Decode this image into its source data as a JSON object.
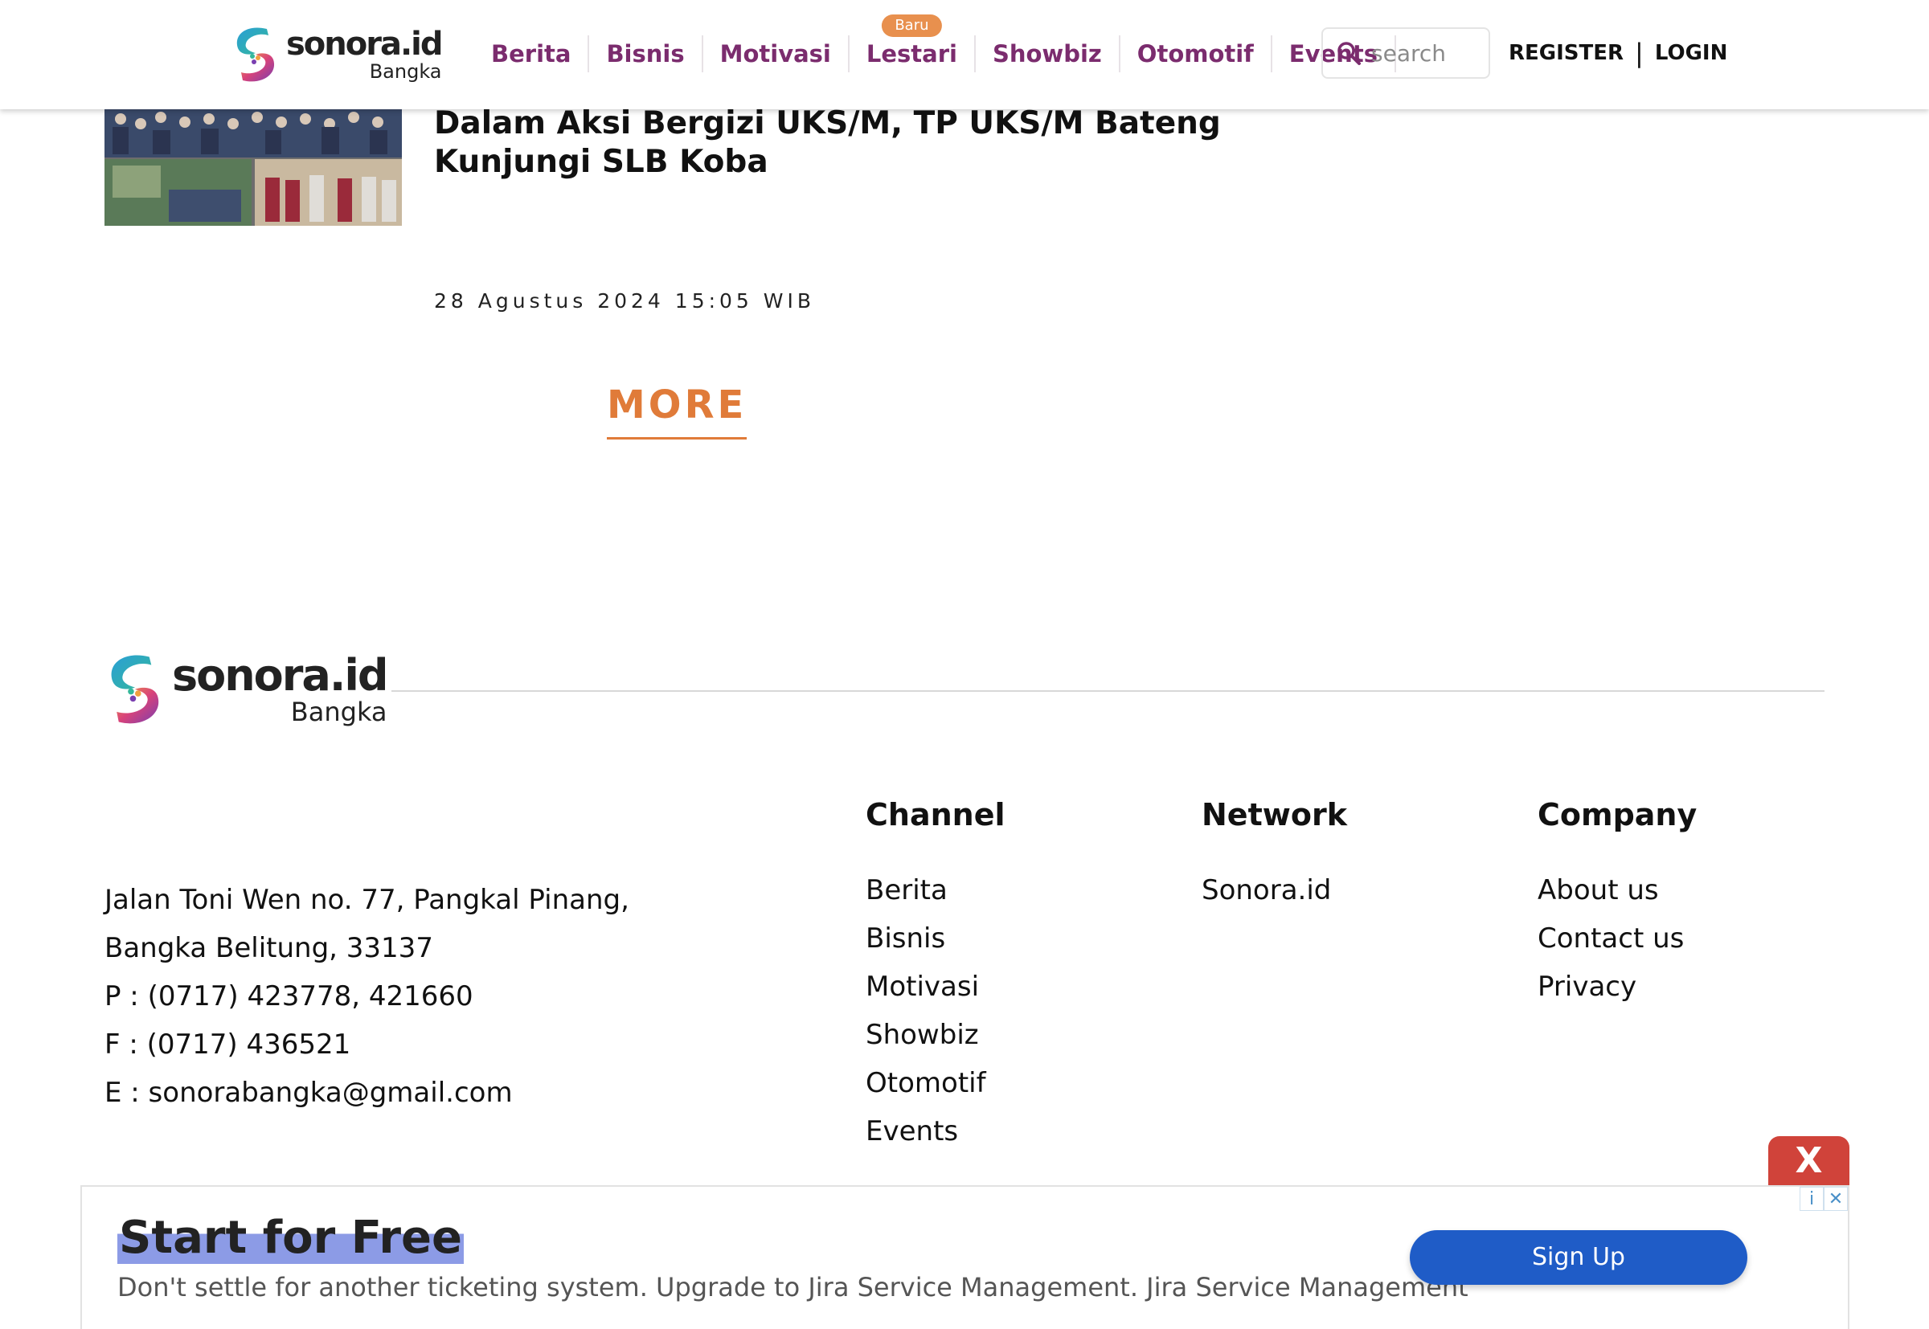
{
  "header": {
    "logo": {
      "word": "sonora.id",
      "sub": "Bangka"
    },
    "nav": [
      {
        "label": "Berita"
      },
      {
        "label": "Bisnis"
      },
      {
        "label": "Motivasi"
      },
      {
        "label": "Lestari",
        "badge": "Baru"
      },
      {
        "label": "Showbiz"
      },
      {
        "label": "Otomotif"
      },
      {
        "label": "Events"
      }
    ],
    "search": {
      "placeholder": "search",
      "icon": "search-icon"
    },
    "auth": {
      "register": "REGISTER",
      "separator": "|",
      "login": "LOGIN"
    }
  },
  "article": {
    "title": "Dalam Aksi Bergizi UKS/M, TP UKS/M Bateng Kunjungi SLB Koba",
    "date": "28 Agustus 2024 15:05 WIB"
  },
  "more_label": "MORE",
  "footer": {
    "logo": {
      "word": "sonora.id",
      "sub": "Bangka"
    },
    "address_lines": [
      "Jalan Toni Wen no. 77, Pangkal Pinang,",
      "Bangka Belitung, 33137",
      "P : (0717) 423778, 421660",
      "F : (0717) 436521",
      "E : sonorabangka@gmail.com"
    ],
    "columns": {
      "channel": {
        "title": "Channel",
        "links": [
          "Berita",
          "Bisnis",
          "Motivasi",
          "Showbiz",
          "Otomotif",
          "Events"
        ]
      },
      "network": {
        "title": "Network",
        "links": [
          "Sonora.id"
        ]
      },
      "company": {
        "title": "Company",
        "links": [
          "About us",
          "Contact us",
          "Privacy"
        ]
      }
    }
  },
  "ad": {
    "close_label": "X",
    "title": "Start for Free",
    "description": "Don't settle for another ticketing system. Upgrade to Jira Service Management. Jira Service Management",
    "button": "Sign Up",
    "info_icon": "i",
    "x_icon": "✕"
  },
  "colors": {
    "brand_purple": "#7b2c6e",
    "accent_orange": "#e07b39",
    "badge_orange": "#e8904e",
    "ad_button_blue": "#1f5cc7",
    "ad_close_red": "#d0433a"
  }
}
